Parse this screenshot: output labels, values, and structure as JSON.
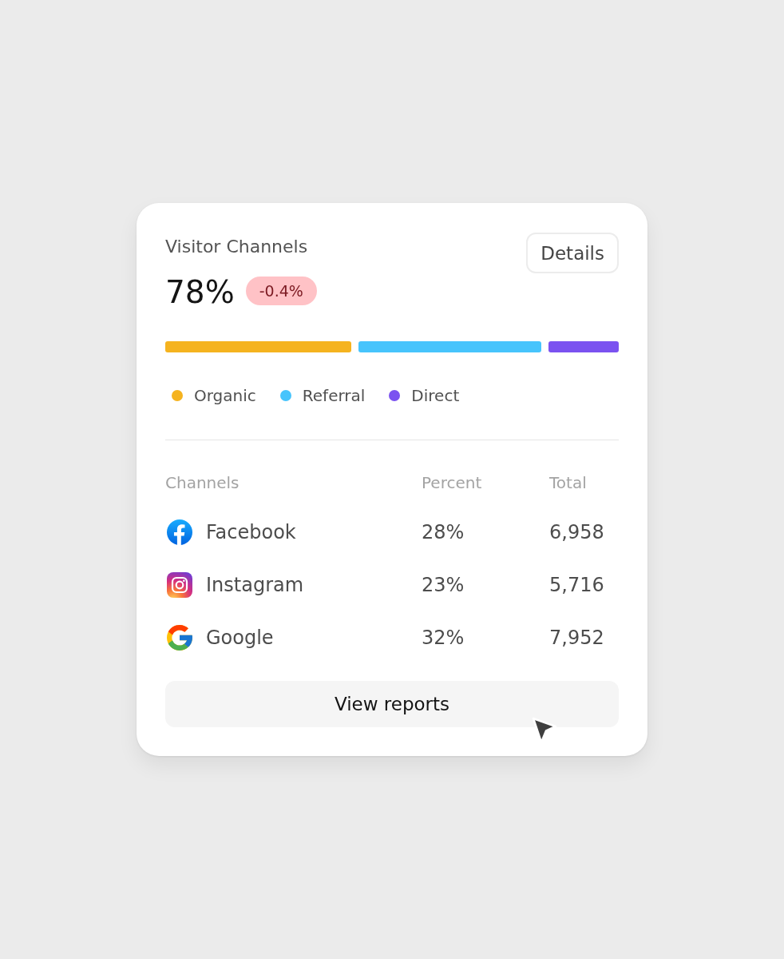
{
  "card": {
    "title": "Visitor Channels",
    "details_button": "Details",
    "value": "78%",
    "change": "-0.4%"
  },
  "mix": [
    {
      "label": "Organic",
      "color": "#f5b31f"
    },
    {
      "label": "Referral",
      "color": "#47c4fc"
    },
    {
      "label": "Direct",
      "color": "#7b52f0"
    }
  ],
  "table": {
    "columns": [
      "Channels",
      "Percent",
      "Total"
    ],
    "rows": [
      {
        "channel": "Facebook",
        "percent": "28%",
        "total": "6,958"
      },
      {
        "channel": "Instagram",
        "percent": "23%",
        "total": "5,716"
      },
      {
        "channel": "Google",
        "percent": "32%",
        "total": "7,952"
      }
    ]
  },
  "action_button": "View reports"
}
